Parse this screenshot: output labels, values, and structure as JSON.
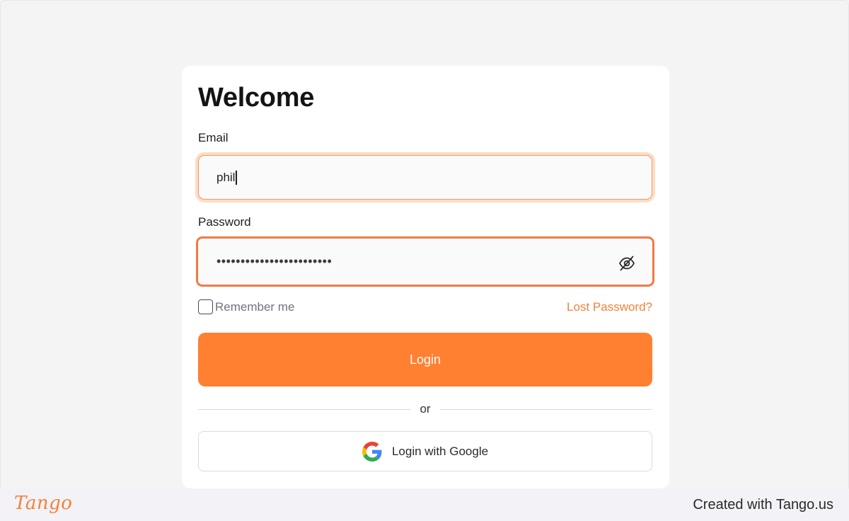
{
  "login_card": {
    "title": "Welcome",
    "email": {
      "label": "Email",
      "value": "phil"
    },
    "password": {
      "label": "Password",
      "value": "••••••••••••••••••••••••",
      "toggle_icon": "eye-off-icon"
    },
    "remember_me": {
      "label": "Remember me",
      "checked": false
    },
    "lost_password_label": "Lost Password?",
    "login_button_label": "Login",
    "divider_text": "or",
    "google_button": {
      "label": "Login with Google",
      "icon": "google-icon"
    }
  },
  "footer": {
    "logo_text": "Tango",
    "created_with": "Created with Tango.us"
  },
  "colors": {
    "accent": "#ff8030",
    "link": "#f2813a",
    "focus_ring": "#fddcc6",
    "password_border": "#f27a45"
  }
}
